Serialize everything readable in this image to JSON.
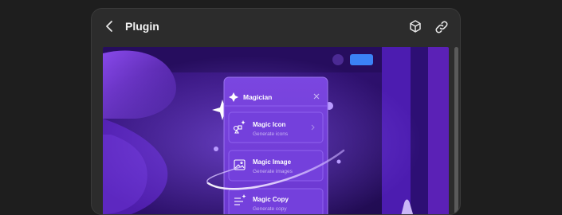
{
  "header": {
    "title": "Plugin",
    "back_icon": "chevron-left-icon",
    "actions": [
      {
        "icon": "package-icon"
      },
      {
        "icon": "link-icon"
      }
    ]
  },
  "preview": {
    "top_button_color": "#3b82f6",
    "magician_panel": {
      "title": "Magician",
      "items": [
        {
          "label": "Magic Icon",
          "subtitle": "Generate icons",
          "icon": "shapes-sparkle-icon"
        },
        {
          "label": "Magic Image",
          "subtitle": "Generate images",
          "icon": "image-sparkle-icon"
        },
        {
          "label": "Magic Copy",
          "subtitle": "Generate copy",
          "icon": "text-sparkle-icon"
        }
      ]
    }
  },
  "colors": {
    "background": "#1e1e1e",
    "panel": "#2c2c2c",
    "accent_purple": "#5b21b6"
  }
}
